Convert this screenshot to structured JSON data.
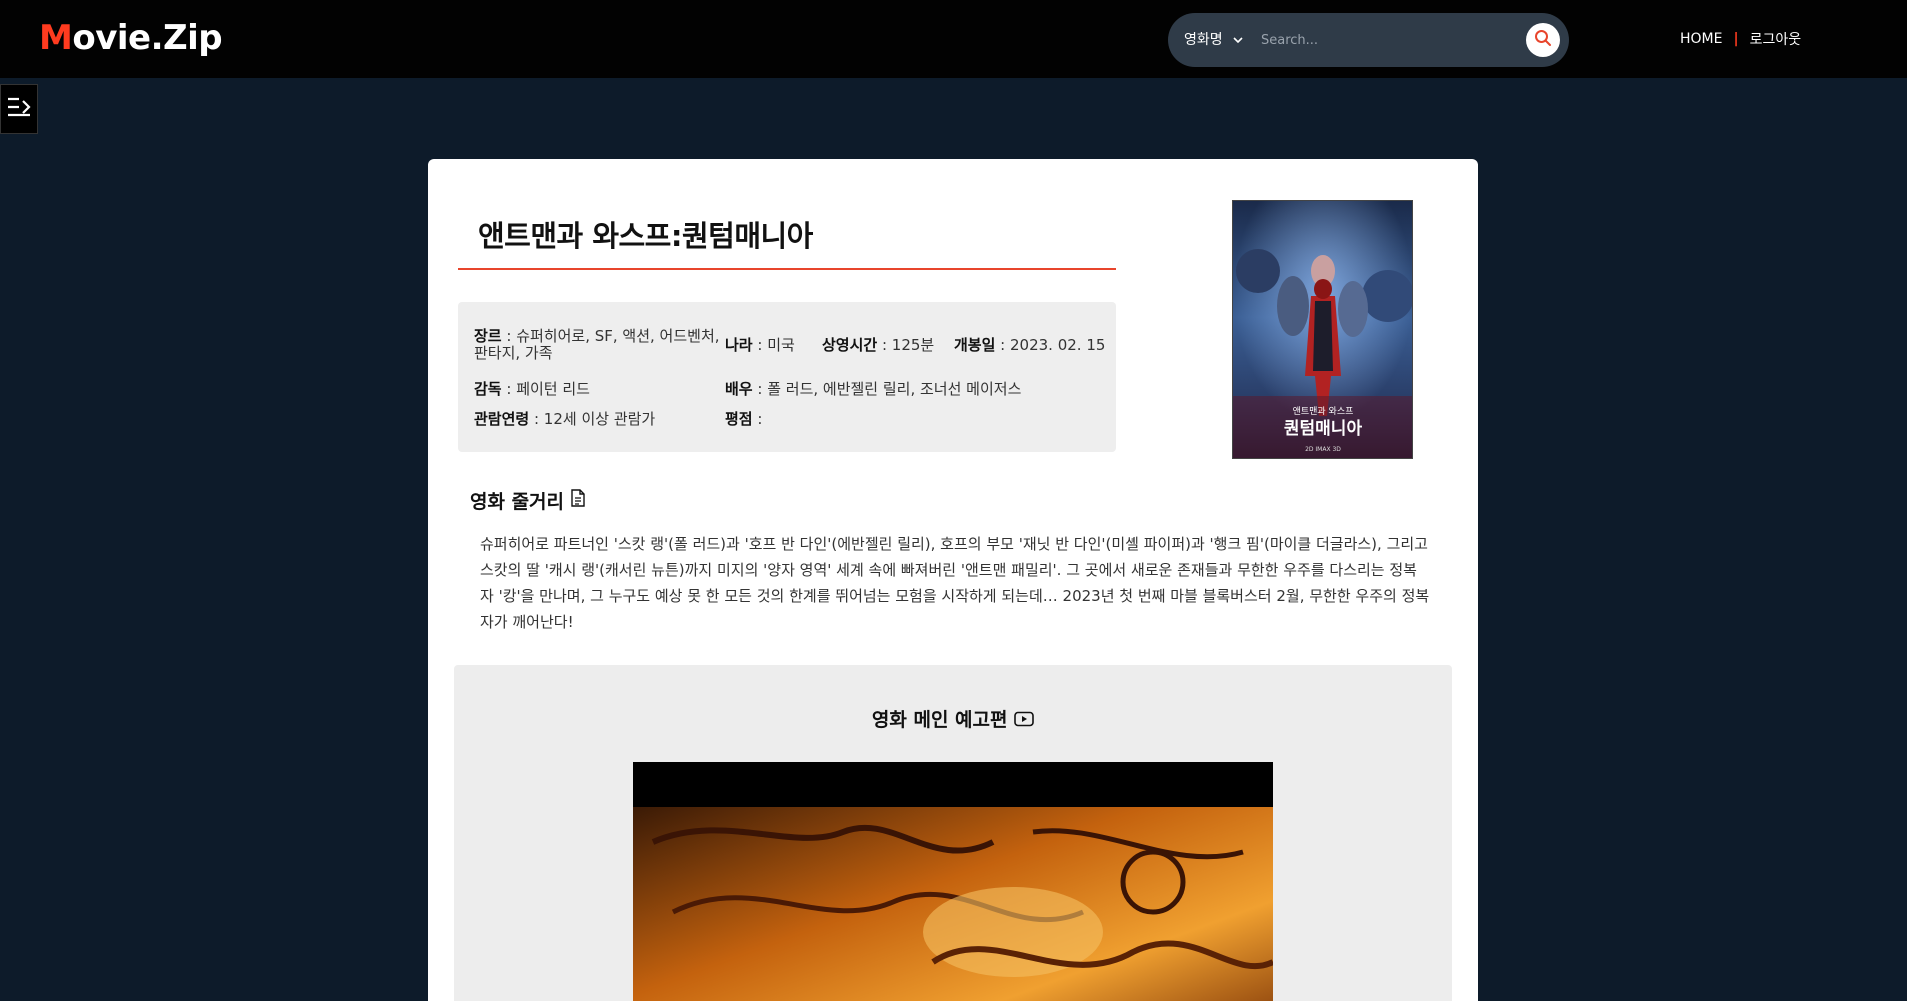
{
  "header": {
    "logo": {
      "first": "M",
      "rest": "ovie.Zip"
    },
    "search": {
      "category": "영화명",
      "placeholder": "Search..."
    },
    "nav": {
      "home": "HOME",
      "logout": "로그아웃"
    }
  },
  "movie": {
    "title": "앤트맨과 와스프:퀀텀매니아",
    "info": {
      "genre_label": "장르",
      "genre": " : 슈퍼히어로, SF, 액션, 어드벤처,",
      "genre_cont": "판타지, 가족",
      "country_label": "나라",
      "country": " : 미국",
      "runtime_label": "상영시간",
      "runtime": " : 125분",
      "release_label": "개봉일",
      "release": " : 2023. 02. 15",
      "director_label": "감독",
      "director": " : 페이턴 리드",
      "cast_label": "배우",
      "cast": " : 폴 러드, 에반젤린 릴리, 조너선 메이저스",
      "rating_label": "관람연령",
      "rating": " : 12세 이상 관람가",
      "score_label": "평점",
      "score": " : "
    },
    "poster": {
      "small_title": "앤트맨과 와스프",
      "big_title": "퀀텀매니아",
      "bottom": "2D IMAX 3D"
    },
    "synopsis_heading": "영화 줄거리",
    "synopsis": "슈퍼히어로 파트너인 '스캇 랭'(폴 러드)과 '호프 반 다인'(에반젤린 릴리), 호프의 부모 '재닛 반 다인'(미셸 파이퍼)과 '행크 핌'(마이클 더글라스), 그리고 스캇의 딸 '캐시 랭'(캐서린 뉴튼)까지 미지의 '양자 영역' 세계 속에 빠져버린 '앤트맨 패밀리'. 그 곳에서 새로운 존재들과 무한한 우주를 다스리는 정복자 '캉'을 만나며, 그 누구도 예상 못 한 모든 것의 한계를 뛰어넘는 모험을 시작하게 되는데… 2023년 첫 번째 마블 블록버스터 2월, 무한한 우주의 정복자가 깨어난다!",
    "trailer_heading": "영화 메인 예고편"
  }
}
